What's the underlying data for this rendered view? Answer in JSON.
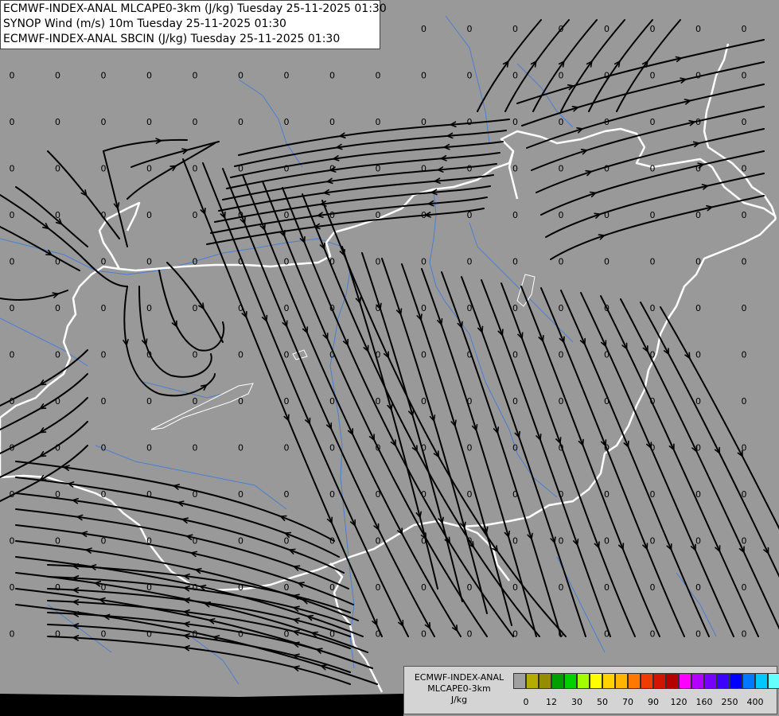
{
  "titles": [
    "ECMWF-INDEX-ANAL MLCAPE0-3km (J/kg) Tuesday 25-11-2025 01:30",
    "SYNOP Wind (m/s) 10m Tuesday 25-11-2025 01:30",
    "ECMWF-INDEX-ANAL SBCIN (J/kg) Tuesday 25-11-2025 01:30"
  ],
  "legend": {
    "line1": "ECMWF-INDEX-ANAL",
    "line2": "MLCAPE0-3km",
    "unit": "J/kg",
    "colors": [
      "#a0a0a0",
      "#b4ad00",
      "#968c00",
      "#00a000",
      "#00d200",
      "#a0ff00",
      "#ffff00",
      "#ffd200",
      "#ffb400",
      "#ff7800",
      "#f03c00",
      "#d21400",
      "#b40000",
      "#ff00ff",
      "#b400ff",
      "#7800ff",
      "#3c00ff",
      "#0000ff",
      "#0078ff",
      "#00c8ff",
      "#64ffff",
      "#ffffff"
    ],
    "ticks": [
      {
        "label": "0",
        "after": 0
      },
      {
        "label": "12",
        "after": 2
      },
      {
        "label": "30",
        "after": 4
      },
      {
        "label": "50",
        "after": 6
      },
      {
        "label": "70",
        "after": 8
      },
      {
        "label": "90",
        "after": 10
      },
      {
        "label": "120",
        "after": 12
      },
      {
        "label": "160",
        "after": 14
      },
      {
        "label": "250",
        "after": 16
      },
      {
        "label": "400",
        "after": 18
      }
    ]
  },
  "map": {
    "background": "#999999",
    "border_color": "#ffffff",
    "river_color": "#4a7fd0",
    "streamline_color": "#000000",
    "cin_value": "0"
  }
}
